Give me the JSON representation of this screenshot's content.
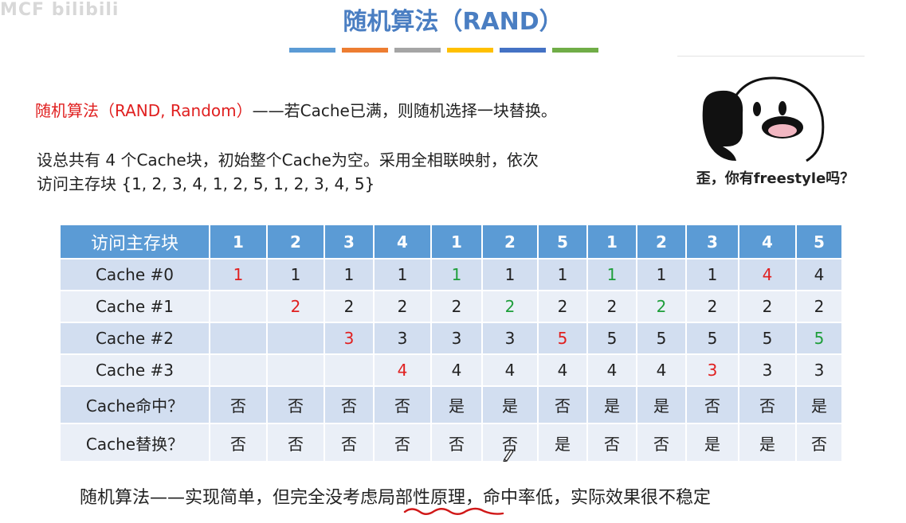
{
  "watermark": "MCF bilibili",
  "title": "随机算法（RAND）",
  "colors": {
    "title": "#4a7ec2",
    "accent_red": "#e02020",
    "accent_green": "#1e9e3a",
    "bars": [
      "#5b9bd5",
      "#ed7d31",
      "#a5a5a5",
      "#ffc000",
      "#4472c4",
      "#70ad47"
    ]
  },
  "definition": {
    "term": "随机算法（RAND, Random）",
    "rest": "——若Cache已满，则随机选择一块替换。"
  },
  "question": {
    "line1": "设总共有 4 个Cache块，初始整个Cache为空。采用全相联映射，依次",
    "line2": "访问主存块 {1, 2, 3, 4, 1, 2, 5, 1, 2, 3, 4, 5}"
  },
  "meme": {
    "caption": "歪，你有freestyle吗？",
    "icon": "meme-face-with-phone"
  },
  "table": {
    "header_label": "访问主存块",
    "accesses": [
      "1",
      "2",
      "3",
      "4",
      "1",
      "2",
      "5",
      "1",
      "2",
      "3",
      "4",
      "5"
    ],
    "rows": [
      {
        "label": "Cache #0",
        "cells": [
          {
            "v": "1",
            "c": "red"
          },
          {
            "v": "1",
            "c": ""
          },
          {
            "v": "1",
            "c": ""
          },
          {
            "v": "1",
            "c": ""
          },
          {
            "v": "1",
            "c": "green"
          },
          {
            "v": "1",
            "c": ""
          },
          {
            "v": "1",
            "c": ""
          },
          {
            "v": "1",
            "c": "green"
          },
          {
            "v": "1",
            "c": ""
          },
          {
            "v": "1",
            "c": ""
          },
          {
            "v": "4",
            "c": "red"
          },
          {
            "v": "4",
            "c": ""
          }
        ]
      },
      {
        "label": "Cache #1",
        "cells": [
          {
            "v": "",
            "c": ""
          },
          {
            "v": "2",
            "c": "red"
          },
          {
            "v": "2",
            "c": ""
          },
          {
            "v": "2",
            "c": ""
          },
          {
            "v": "2",
            "c": ""
          },
          {
            "v": "2",
            "c": "green"
          },
          {
            "v": "2",
            "c": ""
          },
          {
            "v": "2",
            "c": ""
          },
          {
            "v": "2",
            "c": "green"
          },
          {
            "v": "2",
            "c": ""
          },
          {
            "v": "2",
            "c": ""
          },
          {
            "v": "2",
            "c": ""
          }
        ]
      },
      {
        "label": "Cache #2",
        "cells": [
          {
            "v": "",
            "c": ""
          },
          {
            "v": "",
            "c": ""
          },
          {
            "v": "3",
            "c": "red"
          },
          {
            "v": "3",
            "c": ""
          },
          {
            "v": "3",
            "c": ""
          },
          {
            "v": "3",
            "c": ""
          },
          {
            "v": "5",
            "c": "red"
          },
          {
            "v": "5",
            "c": ""
          },
          {
            "v": "5",
            "c": ""
          },
          {
            "v": "5",
            "c": ""
          },
          {
            "v": "5",
            "c": ""
          },
          {
            "v": "5",
            "c": "green"
          }
        ]
      },
      {
        "label": "Cache #3",
        "cells": [
          {
            "v": "",
            "c": ""
          },
          {
            "v": "",
            "c": ""
          },
          {
            "v": "",
            "c": ""
          },
          {
            "v": "4",
            "c": "red"
          },
          {
            "v": "4",
            "c": ""
          },
          {
            "v": "4",
            "c": ""
          },
          {
            "v": "4",
            "c": ""
          },
          {
            "v": "4",
            "c": ""
          },
          {
            "v": "4",
            "c": ""
          },
          {
            "v": "3",
            "c": "red"
          },
          {
            "v": "3",
            "c": ""
          },
          {
            "v": "3",
            "c": ""
          }
        ]
      },
      {
        "label": "Cache命中？",
        "cells": [
          {
            "v": "否",
            "c": ""
          },
          {
            "v": "否",
            "c": ""
          },
          {
            "v": "否",
            "c": ""
          },
          {
            "v": "否",
            "c": ""
          },
          {
            "v": "是",
            "c": ""
          },
          {
            "v": "是",
            "c": ""
          },
          {
            "v": "否",
            "c": ""
          },
          {
            "v": "是",
            "c": ""
          },
          {
            "v": "是",
            "c": ""
          },
          {
            "v": "否",
            "c": ""
          },
          {
            "v": "否",
            "c": ""
          },
          {
            "v": "是",
            "c": ""
          }
        ]
      },
      {
        "label": "Cache替换？",
        "cells": [
          {
            "v": "否",
            "c": ""
          },
          {
            "v": "否",
            "c": ""
          },
          {
            "v": "否",
            "c": ""
          },
          {
            "v": "否",
            "c": ""
          },
          {
            "v": "否",
            "c": ""
          },
          {
            "v": "否",
            "c": ""
          },
          {
            "v": "是",
            "c": ""
          },
          {
            "v": "否",
            "c": ""
          },
          {
            "v": "否",
            "c": ""
          },
          {
            "v": "是",
            "c": ""
          },
          {
            "v": "是",
            "c": ""
          },
          {
            "v": "否",
            "c": ""
          }
        ]
      }
    ]
  },
  "conclusion": "随机算法——实现简单，但完全没考虑局部性原理，命中率低，实际效果很不稳定"
}
